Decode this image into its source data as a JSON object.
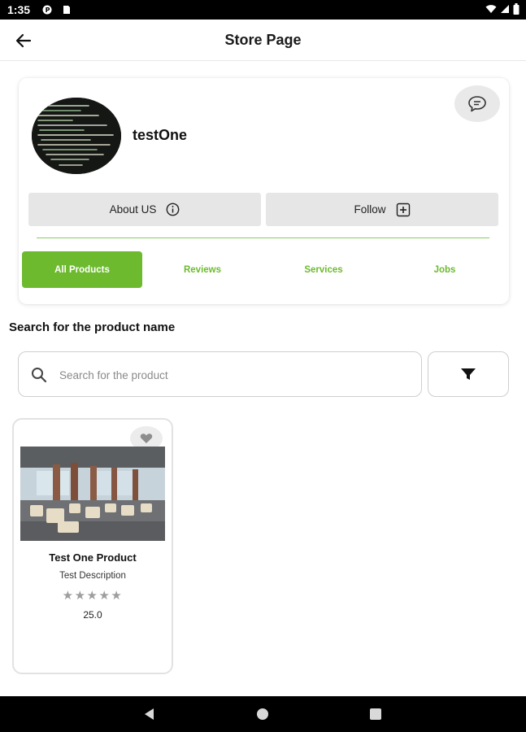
{
  "status_bar": {
    "time": "1:35",
    "icons": [
      "notification-p-icon",
      "sim-card-icon",
      "wifi-icon",
      "cellular-icon",
      "battery-icon"
    ]
  },
  "app_bar": {
    "title": "Store Page",
    "back_icon": "arrow-left-icon"
  },
  "store": {
    "name": "testOne",
    "avatar_icon": "code-screen-avatar",
    "chat_icon": "chat-bubble-icon",
    "about_label": "About US",
    "about_icon": "info-icon",
    "follow_label": "Follow",
    "follow_icon": "plus-box-icon"
  },
  "tabs": [
    {
      "label": "All Products",
      "active": true
    },
    {
      "label": "Reviews",
      "active": false
    },
    {
      "label": "Services",
      "active": false
    },
    {
      "label": "Jobs",
      "active": false
    }
  ],
  "search": {
    "heading": "Search for the product name",
    "placeholder": "Search for the product",
    "value": "",
    "filter_icon": "filter-funnel-icon"
  },
  "products": [
    {
      "name": "Test One Product",
      "description": "Test Description",
      "rating": 0,
      "rating_max": 5,
      "price": "25.0",
      "favorite_icon": "heart-icon",
      "image": "restaurant-interior-photo"
    }
  ],
  "colors": {
    "accent": "#6dba2f",
    "divider": "#86cf5f",
    "button_bg": "#e6e6e6",
    "star": "#9e9e9e"
  },
  "nav_bar": {
    "icons": [
      "nav-back-triangle-icon",
      "nav-home-circle-icon",
      "nav-recents-square-icon"
    ]
  }
}
